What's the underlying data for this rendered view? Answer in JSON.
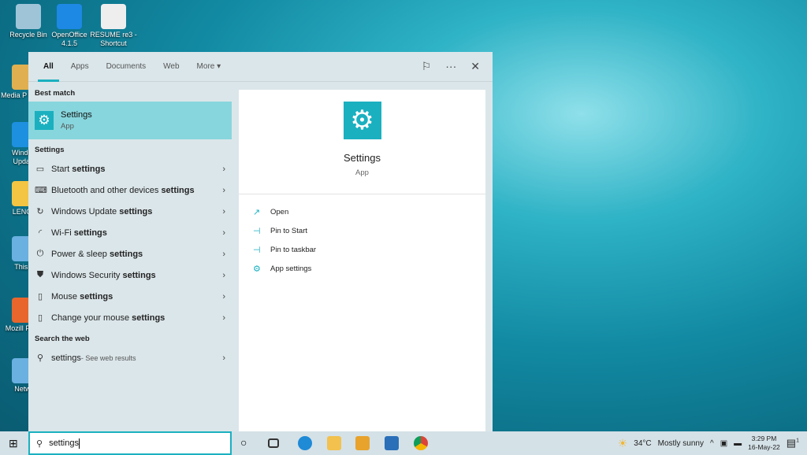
{
  "desktop": {
    "icons": [
      {
        "label": "Recycle Bin",
        "color": "#9fc4d8"
      },
      {
        "label": "OpenOffice 4.1.5",
        "color": "#1e88e5"
      },
      {
        "label": "RESUME re3 - Shortcut",
        "color": "#eeeeee"
      },
      {
        "label": "Media P Classi",
        "color": "#e0b050"
      },
      {
        "label": "Window Update",
        "color": "#1e90e0"
      },
      {
        "label": "LENOV",
        "color": "#f4c542"
      },
      {
        "label": "This P",
        "color": "#6ab0e0"
      },
      {
        "label": "Mozill Firefo",
        "color": "#e8662c"
      },
      {
        "label": "Netwo",
        "color": "#6ab0e0"
      }
    ]
  },
  "search_panel": {
    "tabs": [
      {
        "label": "All"
      },
      {
        "label": "Apps"
      },
      {
        "label": "Documents"
      },
      {
        "label": "Web"
      },
      {
        "label": "More ▾"
      }
    ],
    "best_match_header": "Best match",
    "best_match": {
      "name": "Settings",
      "type": "App"
    },
    "settings_header": "Settings",
    "settings_items": [
      {
        "pre": "Start ",
        "bold": "settings",
        "icon": "▭"
      },
      {
        "pre": "Bluetooth and other devices ",
        "bold": "settings",
        "icon": "⌨"
      },
      {
        "pre": "Windows Update ",
        "bold": "settings",
        "icon": "↻"
      },
      {
        "pre": "Wi-Fi ",
        "bold": "settings",
        "icon": "◜"
      },
      {
        "pre": "Power & sleep ",
        "bold": "settings",
        "icon": "⏻"
      },
      {
        "pre": "Windows Security ",
        "bold": "settings",
        "icon": "⛊"
      },
      {
        "pre": "Mouse ",
        "bold": "settings",
        "icon": "▯"
      },
      {
        "pre": "Change your mouse ",
        "bold": "settings",
        "icon": "▯"
      }
    ],
    "web_header": "Search the web",
    "web_item": {
      "query": "settings",
      "suffix": " - See web results"
    },
    "preview": {
      "name": "Settings",
      "type": "App",
      "actions": [
        {
          "label": "Open",
          "icon": "↗"
        },
        {
          "label": "Pin to Start",
          "icon": "⊣"
        },
        {
          "label": "Pin to taskbar",
          "icon": "⊣"
        },
        {
          "label": "App settings",
          "icon": "⚙"
        }
      ]
    }
  },
  "taskbar": {
    "search_value": "settings",
    "weather_temp": "34°C",
    "weather_text": "Mostly sunny",
    "time": "3:29 PM",
    "date": "16-May-22",
    "notification_count": "1",
    "accent": "#1ab0c0"
  }
}
